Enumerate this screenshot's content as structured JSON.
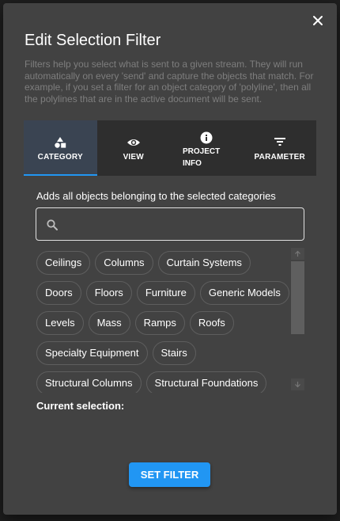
{
  "dialog": {
    "title": "Edit Selection Filter",
    "description": "Filters help you select what is sent to a given stream. They will run automatically on every 'send' and capture the objects that match. For example, if you set a filter for an object category of 'polyline', then all the polylines that are in the active document will be sent.",
    "close_icon": "close-icon"
  },
  "tabs": [
    {
      "label": "CATEGORY",
      "icon": "shapes-icon",
      "active": true
    },
    {
      "label": "VIEW",
      "icon": "eye-icon",
      "active": false
    },
    {
      "label": "PROJECT INFO",
      "icon": "info-icon",
      "active": false
    },
    {
      "label": "PARAMETER",
      "icon": "filter-icon",
      "active": false
    }
  ],
  "category_panel": {
    "hint": "Adds all objects belonging to the selected categories",
    "search": {
      "value": "",
      "placeholder": "",
      "icon": "search-icon"
    },
    "chips": [
      "Ceilings",
      "Columns",
      "Curtain Systems",
      "Doors",
      "Floors",
      "Furniture",
      "Generic Models",
      "Levels",
      "Mass",
      "Ramps",
      "Roofs",
      "Specialty Equipment",
      "Stairs",
      "Structural Columns",
      "Structural Foundations"
    ],
    "current_selection_label": "Current selection:"
  },
  "actions": {
    "set_filter_label": "SET FILTER"
  },
  "colors": {
    "dialog_bg": "#424242",
    "accent": "#2196f3",
    "tab_bar_bg": "#2e2e2e",
    "active_tab_bg": "#3a4452",
    "muted_text": "#7e7e7e"
  }
}
